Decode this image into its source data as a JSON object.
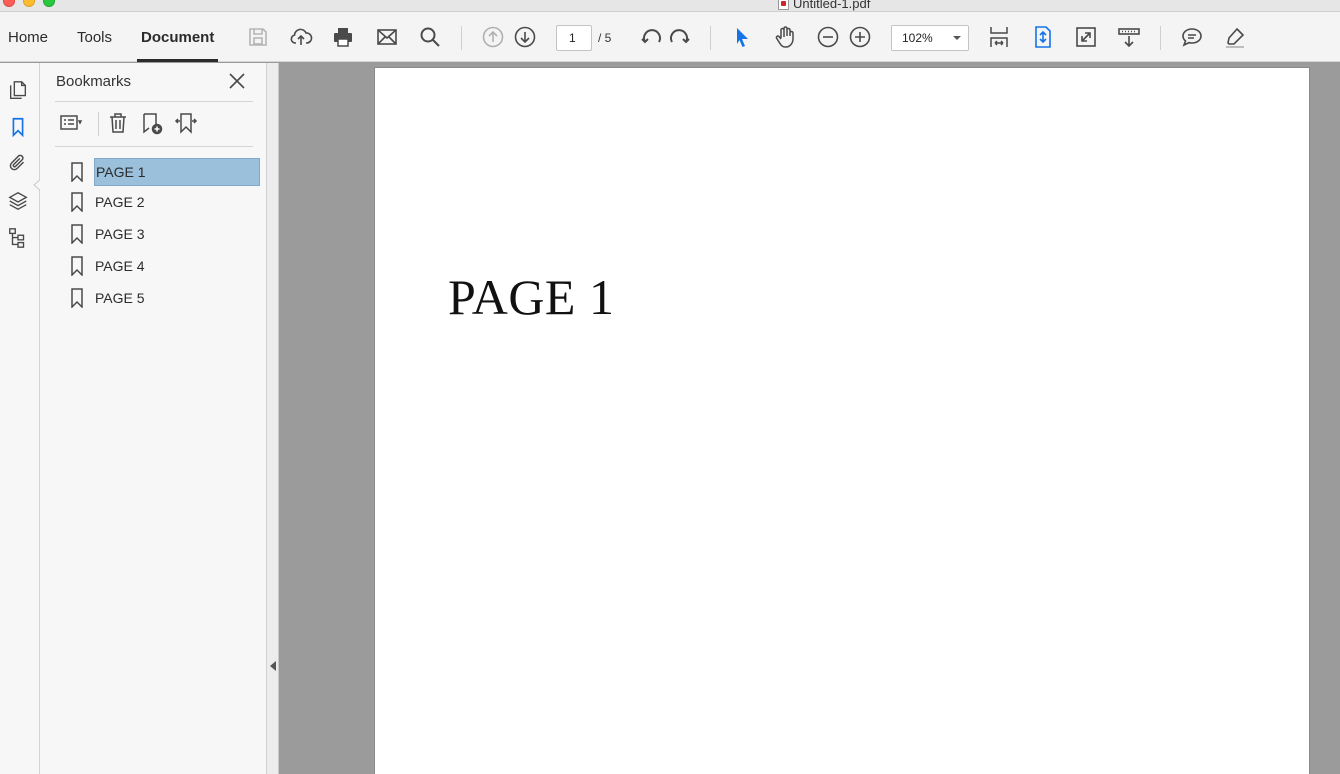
{
  "window": {
    "title": "Untitled-1.pdf"
  },
  "tabs": [
    {
      "label": "Home"
    },
    {
      "label": "Tools"
    },
    {
      "label": "Document"
    }
  ],
  "toolbar": {
    "page_current": "1",
    "page_total": "/  5",
    "zoom": "102%",
    "icons": [
      "save-icon",
      "upload-icon",
      "print-icon",
      "mail-icon",
      "search-icon",
      "prev-page-icon",
      "next-page-icon",
      "rotate-ccw-icon",
      "rotate-cw-icon",
      "select-arrow-icon",
      "hand-icon",
      "zoom-out-icon",
      "zoom-in-icon",
      "fit-width-icon",
      "fit-page-icon",
      "fullscreen-icon",
      "scroll-mode-icon",
      "comment-icon",
      "highlight-icon"
    ]
  },
  "rail": {
    "icons": [
      "pages-icon",
      "bookmarks-icon",
      "attachments-icon",
      "layers-icon",
      "structure-icon"
    ],
    "active": "bookmarks-icon"
  },
  "panel": {
    "title": "Bookmarks",
    "tools": [
      "options-icon",
      "delete-icon",
      "new-bookmark-icon",
      "expand-bookmark-icon"
    ],
    "bookmarks": [
      {
        "label": "PAGE 1",
        "selected": true
      },
      {
        "label": "PAGE 2",
        "selected": false
      },
      {
        "label": "PAGE 3",
        "selected": false
      },
      {
        "label": "PAGE 4",
        "selected": false
      },
      {
        "label": "PAGE 5",
        "selected": false
      }
    ]
  },
  "document": {
    "page_text": "PAGE 1"
  },
  "colors": {
    "accent": "#1473e6",
    "selection": "#9bc0dc",
    "canvas": "#9b9b9b"
  }
}
